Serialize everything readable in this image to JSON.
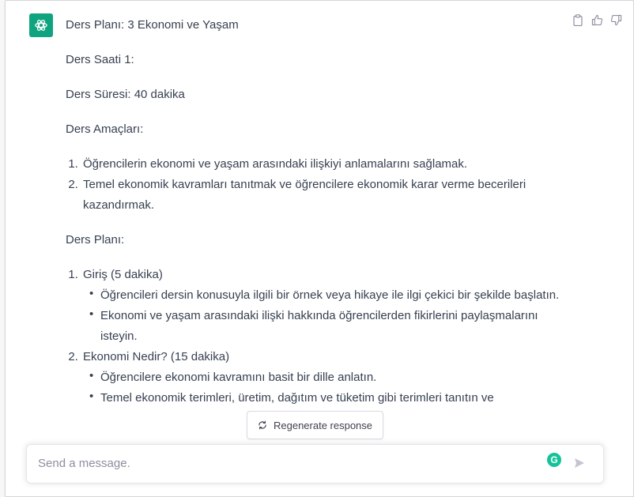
{
  "message": {
    "title": "Ders Planı: 3 Ekonomi ve Yaşam",
    "hour": "Ders Saati 1:",
    "duration": "Ders Süresi: 40 dakika",
    "goals_heading": "Ders Amaçları:",
    "goals": [
      "Öğrencilerin ekonomi ve yaşam arasındaki ilişkiyi anlamalarını sağlamak.",
      "Temel ekonomik kavramları tanıtmak ve öğrencilere ekonomik karar verme becerileri kazandırmak."
    ],
    "plan_heading": "Ders Planı:",
    "plan": [
      {
        "label": "Giriş (5 dakika)",
        "bullets": [
          "Öğrencileri dersin konusuyla ilgili bir örnek veya hikaye ile ilgi çekici bir şekilde başlatın.",
          "Ekonomi ve yaşam arasındaki ilişki hakkında öğrencilerden fikirlerini paylaşmalarını isteyin."
        ]
      },
      {
        "label": "Ekonomi Nedir? (15 dakika)",
        "bullets": [
          "Öğrencilere ekonomi kavramını basit bir dille anlatın.",
          "Temel ekonomik terimleri, üretim, dağıtım ve tüketim gibi terimleri tanıtın ve"
        ]
      }
    ]
  },
  "actions": {
    "copy_icon": "clipboard-icon",
    "like_icon": "thumbs-up-icon",
    "dislike_icon": "thumbs-down-icon"
  },
  "regenerate": {
    "label": "Regenerate response",
    "icon": "refresh-icon"
  },
  "composer": {
    "placeholder": "Send a message.",
    "send_icon": "send-icon",
    "grammarly_letter": "G"
  },
  "colors": {
    "brand": "#10a37f",
    "text": "#374151",
    "placeholder": "#8e8ea0"
  }
}
